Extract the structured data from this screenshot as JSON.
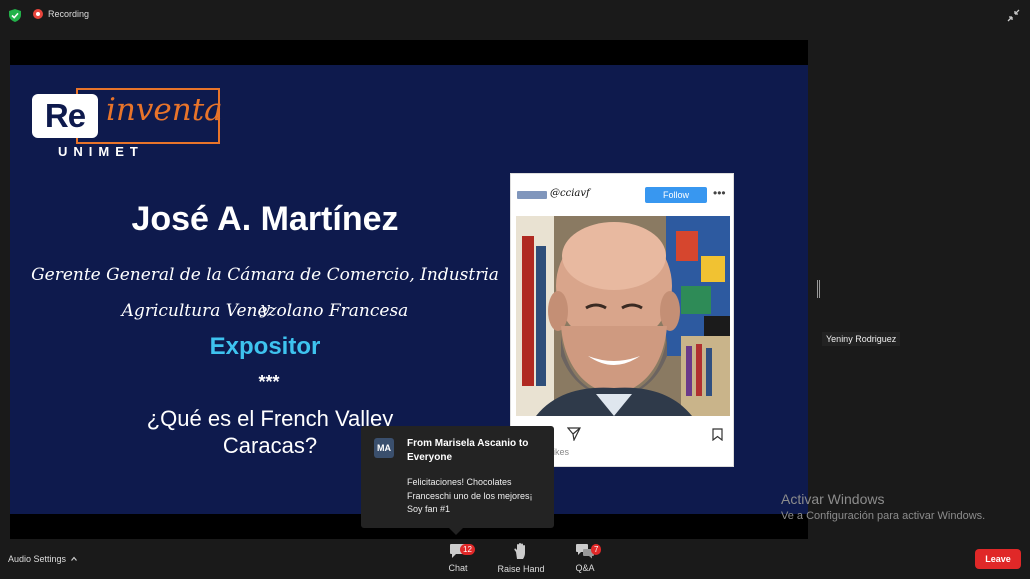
{
  "meeting": {
    "recording_label": "Recording",
    "icons": {
      "security": "shield-check-icon",
      "recording": "record-icon",
      "exit_fullscreen": "exit-fullscreen-icon"
    }
  },
  "slide": {
    "logo": {
      "re": "Re",
      "inventa": "inventa",
      "unimet": "UNIMET"
    },
    "speaker_name": "José A. Martínez",
    "role_line1": "Gerente General de la Cámara de Comercio, Industria y",
    "role_line2": "Agricultura Venezolano Francesa",
    "expositor": "Expositor",
    "stars": "***",
    "question_line1": "¿Qué es el French Valley",
    "question_line2": "Caracas?",
    "colors": {
      "background": "#0e1a4d",
      "accent_orange": "#e8742a",
      "accent_cyan": "#3ec3ef"
    }
  },
  "instagram": {
    "handle": "@cciavf",
    "follow_label": "Follow",
    "more_label": "•••",
    "likes_text": "likes"
  },
  "participant": {
    "name": "Yeniny Rodriguez"
  },
  "chat_toast": {
    "avatar_initials": "MA",
    "from": "From Marisela Ascanio to Everyone",
    "message": "Felicitaciones! Chocolates Franceschi uno de los mejores¡ Soy fan #1"
  },
  "watermark": {
    "title": "Activar Windows",
    "subtitle": "Ve a Configuración para activar Windows."
  },
  "toolbar": {
    "audio_settings_label": "Audio Settings",
    "chat_label": "Chat",
    "chat_badge": "12",
    "raise_hand_label": "Raise Hand",
    "qa_label": "Q&A",
    "qa_badge": "7",
    "leave_label": "Leave",
    "colors": {
      "leave": "#e02828",
      "badge": "#e02828"
    }
  }
}
